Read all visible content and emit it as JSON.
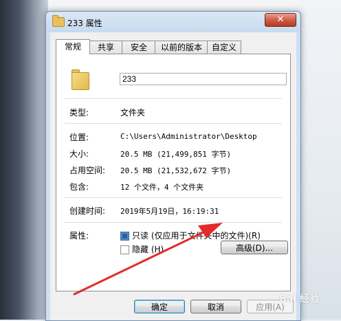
{
  "window": {
    "title": "233 属性",
    "close_glyph": "✕"
  },
  "tabs": [
    {
      "label": "常规",
      "active": true
    },
    {
      "label": "共享",
      "active": false
    },
    {
      "label": "安全",
      "active": false
    },
    {
      "label": "以前的版本",
      "active": false
    },
    {
      "label": "自定义",
      "active": false
    }
  ],
  "general": {
    "name_value": "233",
    "type_label": "类型:",
    "type_value": "文件夹",
    "location_label": "位置:",
    "location_value": "C:\\Users\\Administrator\\Desktop",
    "size_label": "大小:",
    "size_value": "20.5 MB (21,499,851 字节)",
    "disk_size_label": "占用空间:",
    "disk_size_value": "20.5 MB (21,532,672 字节)",
    "contains_label": "包含:",
    "contains_value": "12 个文件，4 个文件夹",
    "created_label": "创建时间:",
    "created_value": "2019年5月19日，16:19:31",
    "attributes_label": "属性:",
    "readonly_label": "只读 (仅应用于文件夹中的文件)(R)",
    "readonly_checked": true,
    "hidden_label": "隐藏 (H)",
    "hidden_checked": false,
    "advanced_button": "高级(D)..."
  },
  "buttons": {
    "ok": "确定",
    "cancel": "取消",
    "apply": "应用(A)"
  },
  "watermark": "Bai 经验",
  "icons": {
    "title": "folder-icon",
    "big": "folder-icon"
  },
  "colors": {
    "annotation_arrow": "#e32b2b"
  }
}
